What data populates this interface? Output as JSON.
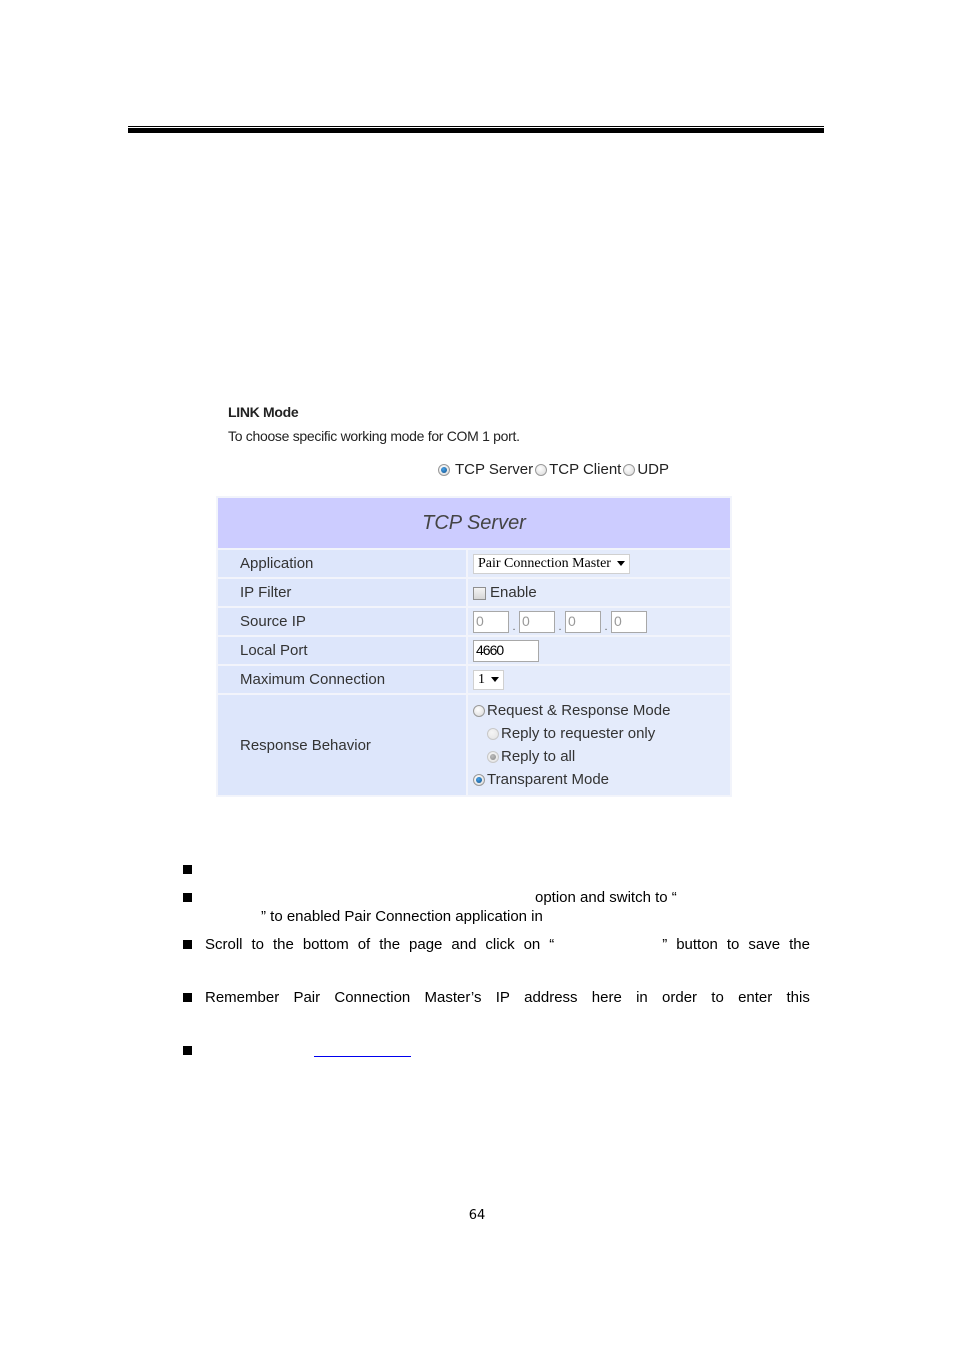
{
  "page": {
    "number": "64"
  },
  "screenshot": {
    "link_mode": {
      "title": "LINK Mode",
      "description": "To choose specific working mode for COM 1 port.",
      "modes": [
        {
          "label": "TCP Server",
          "checked": true
        },
        {
          "label": "TCP Client",
          "checked": false
        },
        {
          "label": "UDP",
          "checked": false
        }
      ]
    },
    "table": {
      "header": "TCP Server",
      "rows": {
        "application": {
          "label": "Application",
          "value": "Pair Connection Master"
        },
        "ip_filter": {
          "label": "IP Filter",
          "checkbox_label": "Enable",
          "checked": false
        },
        "source_ip": {
          "label": "Source IP",
          "octets": [
            "0",
            "0",
            "0",
            "0"
          ],
          "separator": "."
        },
        "local_port": {
          "label": "Local Port",
          "value": "4660"
        },
        "max_connection": {
          "label": "Maximum Connection",
          "value": "1"
        },
        "response_behavior": {
          "label": "Response Behavior",
          "options": [
            {
              "label": "Request & Response Mode",
              "checked": false,
              "disabled": false
            },
            {
              "label": "Reply to requester only",
              "checked": false,
              "disabled": true
            },
            {
              "label": "Reply to all",
              "checked": true,
              "disabled": true
            },
            {
              "label": "Transparent Mode",
              "checked": true,
              "disabled": false
            }
          ]
        }
      }
    }
  },
  "bullets": {
    "b2_line1_tail": "option and switch to “",
    "b2_line2": "” to enabled Pair Connection application in",
    "b3_words": [
      "Scroll",
      "to",
      "the",
      "bottom",
      "of",
      "the",
      "page",
      "and",
      "click",
      "on",
      "“",
      "",
      "”",
      "button",
      "to",
      "save",
      "the"
    ],
    "b4_words": [
      "Remember",
      "Pair",
      "Connection",
      "Master’s",
      "IP",
      "address",
      "here",
      "in",
      "order",
      "to",
      "enter",
      "this"
    ]
  }
}
